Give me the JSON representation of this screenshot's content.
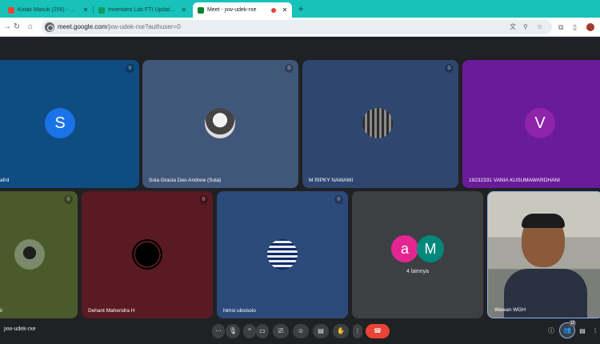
{
  "browser": {
    "tabs": [
      {
        "title": "Kotak Masuk (256) - wawan.wgh",
        "icon": "gmail-icon",
        "active": false
      },
      {
        "title": "Inventaris Lab FTI Update Genap",
        "icon": "sheets-icon",
        "active": false
      },
      {
        "title": "Meet - jxw-udek-rxe",
        "icon": "meet-icon",
        "active": true
      }
    ],
    "new_tab": "+",
    "url_host": "meet.google.com",
    "url_rest": "/jxw-udek-rxe?authuser=0"
  },
  "meet": {
    "tiles": [
      {
        "name": "afrd",
        "avatar_letter": "S",
        "avatar_color": "#1a73e8",
        "bg": "#0f4c81",
        "muted": true
      },
      {
        "name": "Sola Gracia Deo Andrew (Sola)",
        "avatar_type": "photo",
        "bg": "#41577a",
        "muted": true
      },
      {
        "name": "M RIPKY NAWAWI",
        "avatar_type": "photo",
        "bg": "#2f4770",
        "muted": true
      },
      {
        "name": "19232331 VANIA KUSUMAWARDHANI",
        "avatar_letter": "V",
        "avatar_color": "#8e24aa",
        "bg": "#6a1b9a",
        "muted": false
      },
      {
        "name": "il",
        "avatar_type": "photo",
        "bg": "#4a5a2a",
        "muted": true
      },
      {
        "name": "Dehant Mahendra H",
        "avatar_type": "photo",
        "bg": "#5a1a22",
        "muted": true
      },
      {
        "name": "himsi ubsisolo",
        "avatar_type": "photo",
        "bg": "#2c4a7a",
        "muted": true
      },
      {
        "name": "",
        "more_label": "4 lainnya",
        "more_avatars": [
          "a",
          "M"
        ],
        "bg": "#3c4043"
      },
      {
        "name": "Wawan WGH",
        "avatar_type": "video",
        "bg": "#9a9a92",
        "muted": false
      }
    ]
  },
  "controls": {
    "meeting_code": "jxw-udek-rxe",
    "participant_count": "12"
  }
}
